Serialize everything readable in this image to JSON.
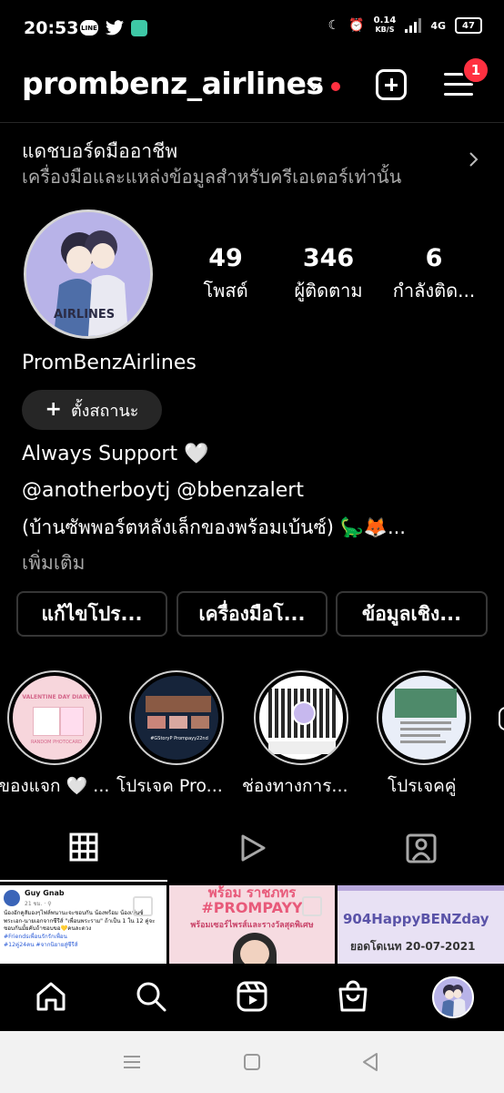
{
  "status_bar": {
    "time": "20:53",
    "line_label": "LINE",
    "net_speed_value": "0.14",
    "net_speed_unit": "KB/S",
    "network": "4G",
    "battery": "47"
  },
  "header": {
    "username": "prombenz_airlines",
    "notification_count": "1"
  },
  "dashboard": {
    "title": "แดชบอร์ดมืออาชีพ",
    "subtitle": "เครื่องมือและแหล่งข้อมูลสำหรับครีเอเตอร์เท่านั้น"
  },
  "profile": {
    "avatar_text": "AIRLINES",
    "stats": [
      {
        "value": "49",
        "label": "โพสต์"
      },
      {
        "value": "346",
        "label": "ผู้ติดตาม"
      },
      {
        "value": "6",
        "label": "กำลังติด..."
      }
    ],
    "display_name": "PromBenzAirlines",
    "status_button": "ตั้งสถานะ",
    "bio_line1": "Always Support 🤍",
    "bio_line2": "@anotherboytj @bbenzalert",
    "bio_line3": "(บ้านซัพพอร์ตหลังเล็กของพร้อมเบ้นซ์) 🦕🦊...",
    "more": "เพิ่มเติม"
  },
  "profile_buttons": [
    "แก้ไขโปร...",
    "เครื่องมือโ...",
    "ข้อมูลเชิง..."
  ],
  "highlights": [
    {
      "label": "ของแจก 🤍 ...",
      "img_title": "VALENTINE DAY DIARY",
      "img_sub": "RANDOM PHOTOCARD"
    },
    {
      "label": "โปรเจค Pro...",
      "img_title": "#GStoryP Prompayy22nd"
    },
    {
      "label": "ช่องทางการ...",
      "img_title": ""
    },
    {
      "label": "โปรเจคคู่",
      "img_title": ""
    }
  ],
  "grid": [
    {
      "author": "Guy Gnab",
      "meta": "21 ชม. · ⚲",
      "text": "น้องอักคูสัมองๆไฟล์พนานะจะชอบกัน น้องพร้อม น้องเบ้นซ์ พระเอก-นายเอกจากซีรีส์ \"เพื่อนพระราม\" ถ้าเป็น 1 ใน 12 คู่จะ ชอบกันมั้ยคับถ้าชอบขอ💛คนละดวง",
      "tags": "#Friendsเพื่อนรักรักเพื่อน #12คู่24คน #จากนิยายสู่ซีรีส์"
    },
    {
      "title_line1": "พร้อม ราชภทร",
      "title_line2": "#PROMPAYY",
      "sub": "พร้อมเซอร์ไพรส์และรางวัลสุดพิเศษ"
    },
    {
      "title": "904HappyBENZday",
      "sub": "ยอดโดเนท  20-07-2021"
    }
  ],
  "colors": {
    "accent_red": "#ff3040",
    "button_bg": "#262626",
    "secondary_text": "#a8a8a8"
  }
}
